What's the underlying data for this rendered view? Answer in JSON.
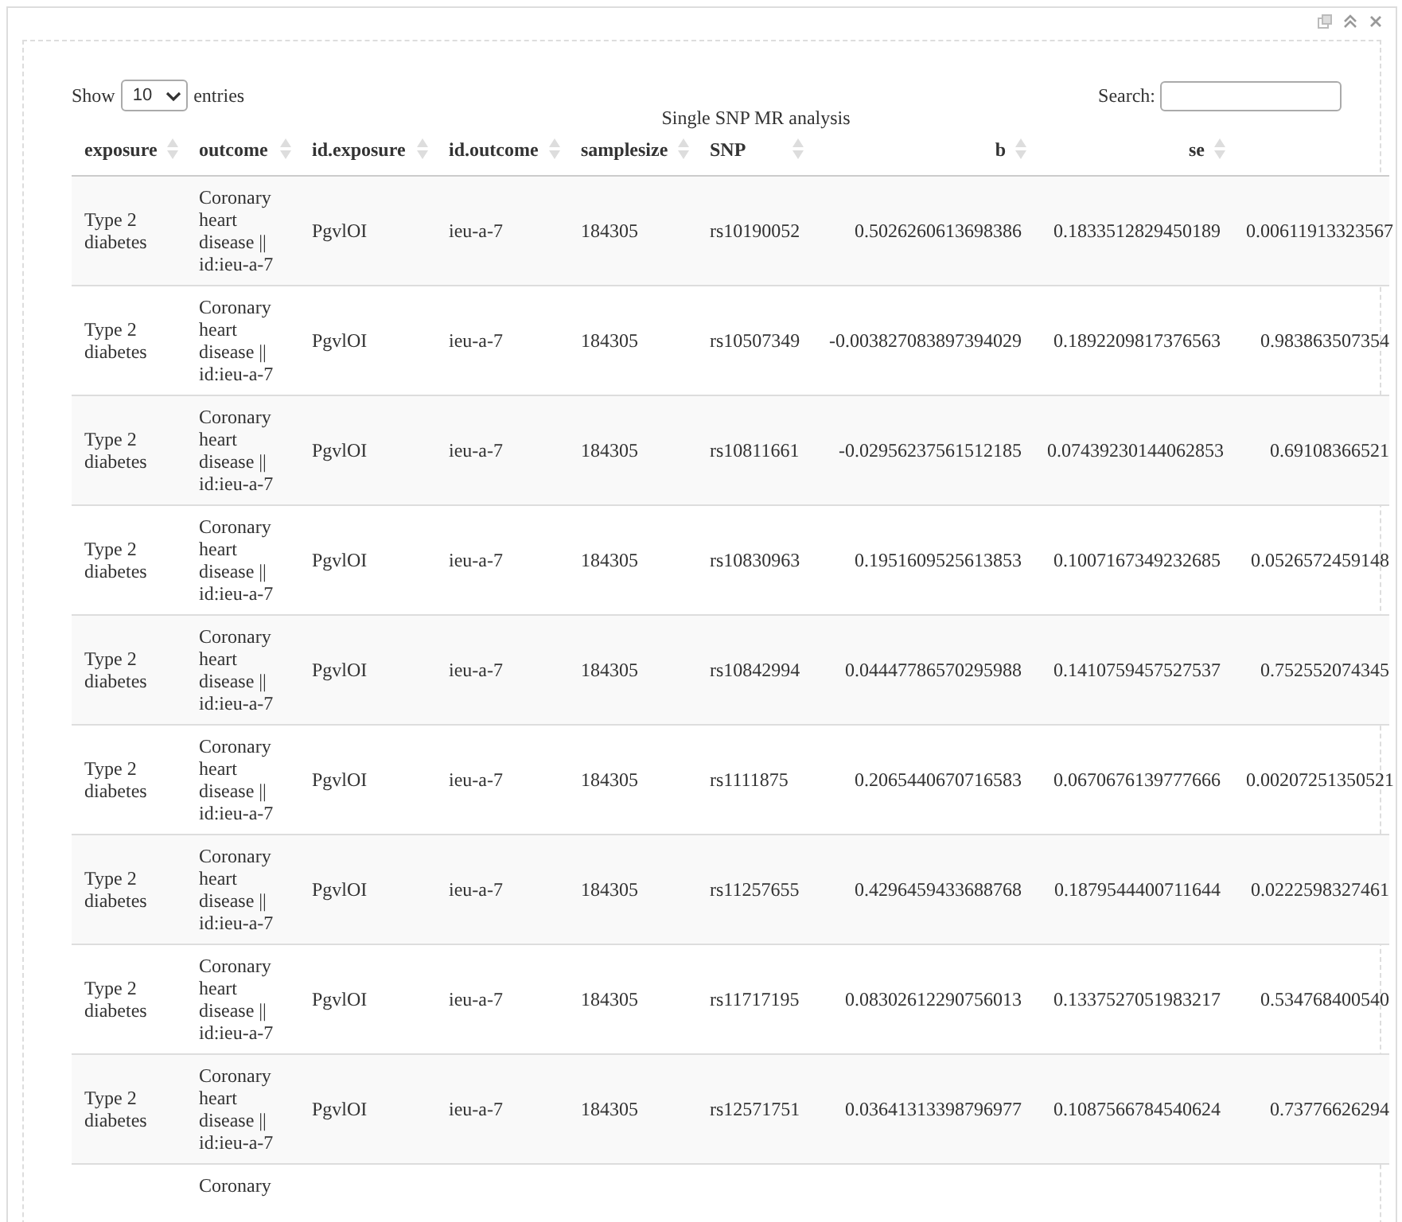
{
  "length_menu": {
    "label_before": "Show",
    "value": "10",
    "label_after": "entries"
  },
  "search": {
    "label": "Search:"
  },
  "table": {
    "caption": "Single SNP MR analysis",
    "columns": [
      {
        "label": "exposure",
        "numeric": false
      },
      {
        "label": "outcome",
        "numeric": false
      },
      {
        "label": "id.exposure",
        "numeric": false
      },
      {
        "label": "id.outcome",
        "numeric": false
      },
      {
        "label": "samplesize",
        "numeric": false
      },
      {
        "label": "SNP",
        "numeric": false
      },
      {
        "label": "b",
        "numeric": true
      },
      {
        "label": "se",
        "numeric": true
      }
    ],
    "rows": [
      [
        "Type 2 diabetes",
        "Coronary heart disease || id:ieu-a-7",
        "PgvlOI",
        "ieu-a-7",
        "184305",
        "rs10190052",
        "0.5026260613698386",
        "0.1833512829450189",
        "0.00611913323567"
      ],
      [
        "Type 2 diabetes",
        "Coronary heart disease || id:ieu-a-7",
        "PgvlOI",
        "ieu-a-7",
        "184305",
        "rs10507349",
        "-0.003827083897394029",
        "0.1892209817376563",
        "0.983863507354"
      ],
      [
        "Type 2 diabetes",
        "Coronary heart disease || id:ieu-a-7",
        "PgvlOI",
        "ieu-a-7",
        "184305",
        "rs10811661",
        "-0.02956237561512185",
        "0.07439230144062853",
        "0.69108366521"
      ],
      [
        "Type 2 diabetes",
        "Coronary heart disease || id:ieu-a-7",
        "PgvlOI",
        "ieu-a-7",
        "184305",
        "rs10830963",
        "0.1951609525613853",
        "0.1007167349232685",
        "0.0526572459148"
      ],
      [
        "Type 2 diabetes",
        "Coronary heart disease || id:ieu-a-7",
        "PgvlOI",
        "ieu-a-7",
        "184305",
        "rs10842994",
        "0.04447786570295988",
        "0.1410759457527537",
        "0.752552074345"
      ],
      [
        "Type 2 diabetes",
        "Coronary heart disease || id:ieu-a-7",
        "PgvlOI",
        "ieu-a-7",
        "184305",
        "rs1111875",
        "0.2065440670716583",
        "0.0670676139777666",
        "0.00207251350521"
      ],
      [
        "Type 2 diabetes",
        "Coronary heart disease || id:ieu-a-7",
        "PgvlOI",
        "ieu-a-7",
        "184305",
        "rs11257655",
        "0.4296459433688768",
        "0.1879544400711644",
        "0.0222598327461"
      ],
      [
        "Type 2 diabetes",
        "Coronary heart disease || id:ieu-a-7",
        "PgvlOI",
        "ieu-a-7",
        "184305",
        "rs11717195",
        "0.08302612290756013",
        "0.1337527051983217",
        "0.534768400540"
      ],
      [
        "Type 2 diabetes",
        "Coronary heart disease || id:ieu-a-7",
        "PgvlOI",
        "ieu-a-7",
        "184305",
        "rs12571751",
        "0.03641313398796977",
        "0.1087566784540624",
        "0.73776626294"
      ],
      [
        "",
        "Coronary",
        "",
        "",
        "",
        "",
        "",
        "",
        ""
      ]
    ]
  }
}
